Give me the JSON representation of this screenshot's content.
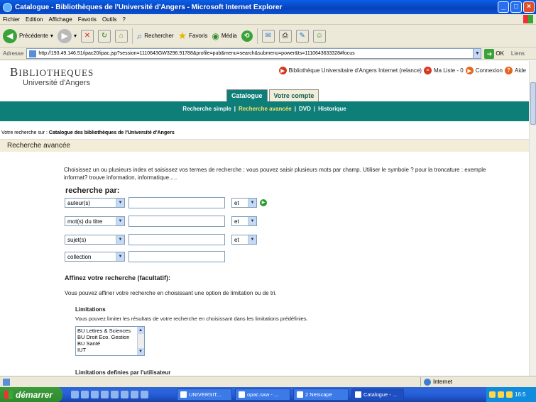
{
  "window": {
    "title": "Catalogue - Bibliothèques de l'Université d'Angers - Microsoft Internet Explorer"
  },
  "menu": [
    "Fichier",
    "Edition",
    "Affichage",
    "Favoris",
    "Outils",
    "?"
  ],
  "toolbar": {
    "back": "Précédente",
    "search": "Rechercher",
    "favorites": "Favoris",
    "media": "Média"
  },
  "address": {
    "label": "Adresse",
    "url": "http://193.49.146.51/ipac20/ipac.jsp?session=1110643GW3296.91788&profile=pub&menu=search&submenu=power&ts=1110643633328#focus",
    "go": "OK",
    "links": "Liens"
  },
  "site": {
    "logo_first": "B",
    "logo_rest": "IBLIOTHEQUES",
    "logo_sub": "Université d'Angers",
    "topnav": {
      "bu_link": "Bibliothèque Universitaire d'Angers Internet (relance)",
      "my_list": "Ma Liste - 0",
      "login": "Connexion",
      "help": "Aide"
    },
    "tabs": [
      "Catalogue",
      "Votre compte"
    ],
    "subnav": [
      "Recherche simple",
      "Recherche avancée",
      "DVD",
      "Historique"
    ],
    "crumb_prefix": "Votre recherche sur : ",
    "crumb_target": "Catalogue des bibliothèques de l'Université d'Angers",
    "section_title": "Recherche avancée",
    "intro": "Choisissez un ou plusieurs index et saisissez vos termes de recherche ; vous pouvez saisir plusieurs mots par champ. Utiliser le symbole ? pour la troncature : exemple informat? trouve information, informatique.....",
    "search_by": "recherche par:",
    "rows": [
      {
        "index": "auteur(s)",
        "op": "et"
      },
      {
        "index": "mot(s) du titre",
        "op": "et"
      },
      {
        "index": "sujet(s)",
        "op": "et"
      },
      {
        "index": "collection",
        "op": ""
      }
    ],
    "refine_title": "Affinez votre recherche (facultatif):",
    "refine_text": "Vous pouvez affiner votre recherche en choisissant une option de limitation ou de tri.",
    "limits_title": "Limitations",
    "limits_text": "Vous pouvez limiter les résultats de votre recherche en choisissant dans les limitations prédéfinies.",
    "limits_options": [
      "BU Lettres & Sciences",
      "BU Droit Eco. Gestion",
      "BU Santé",
      "IUT"
    ],
    "user_limits_title": "Limitations definies par l'utilisateur"
  },
  "status": {
    "zone": "Internet"
  },
  "taskbar": {
    "start": "démarrer",
    "tasks": [
      "UNIVERSIT...",
      "opac.sxw - ...",
      "2 Netscape",
      "Catalogue - ..."
    ],
    "clock": "16:5"
  }
}
